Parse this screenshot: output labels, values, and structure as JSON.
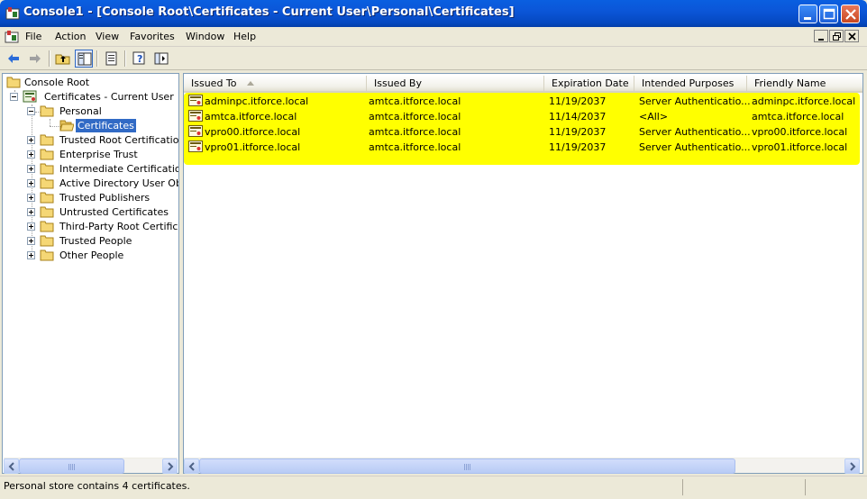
{
  "window": {
    "title": "Console1 - [Console Root\\Certificates - Current User\\Personal\\Certificates]",
    "accent": "#0a5fe0"
  },
  "menu": [
    {
      "label": "File"
    },
    {
      "label": "Action"
    },
    {
      "label": "View"
    },
    {
      "label": "Favorites"
    },
    {
      "label": "Window"
    },
    {
      "label": "Help"
    }
  ],
  "toolbar": {
    "icons": [
      "back-arrow-icon",
      "forward-arrow-icon",
      "up-one-level-icon",
      "show-hide-tree-icon",
      "export-list-icon",
      "help-icon",
      "show-hide-action-pane-icon"
    ]
  },
  "tree": {
    "root": "Console Root",
    "store": "Certificates - Current User",
    "personal": "Personal",
    "certificates": "Certificates",
    "folders": [
      "Trusted Root Certification Authorities",
      "Enterprise Trust",
      "Intermediate Certification Authorities",
      "Active Directory User Object",
      "Trusted Publishers",
      "Untrusted Certificates",
      "Third-Party Root Certification Authorities",
      "Trusted People",
      "Other People"
    ]
  },
  "list": {
    "columns": [
      "Issued To",
      "Issued By",
      "Expiration Date",
      "Intended Purposes",
      "Friendly Name"
    ],
    "rows": [
      {
        "issued_to": "adminpc.itforce.local",
        "issued_by": "amtca.itforce.local",
        "expiration": "11/19/2037",
        "purposes": "Server Authenticatio...",
        "friendly": "adminpc.itforce.local"
      },
      {
        "issued_to": "amtca.itforce.local",
        "issued_by": "amtca.itforce.local",
        "expiration": "11/14/2037",
        "purposes": "<All>",
        "friendly": "amtca.itforce.local"
      },
      {
        "issued_to": "vpro00.itforce.local",
        "issued_by": "amtca.itforce.local",
        "expiration": "11/19/2037",
        "purposes": "Server Authenticatio...",
        "friendly": "vpro00.itforce.local"
      },
      {
        "issued_to": "vpro01.itforce.local",
        "issued_by": "amtca.itforce.local",
        "expiration": "11/19/2037",
        "purposes": "Server Authenticatio...",
        "friendly": "vpro01.itforce.local"
      }
    ],
    "highlight_color": "#ffff00"
  },
  "status": {
    "text": "Personal store contains 4 certificates."
  }
}
